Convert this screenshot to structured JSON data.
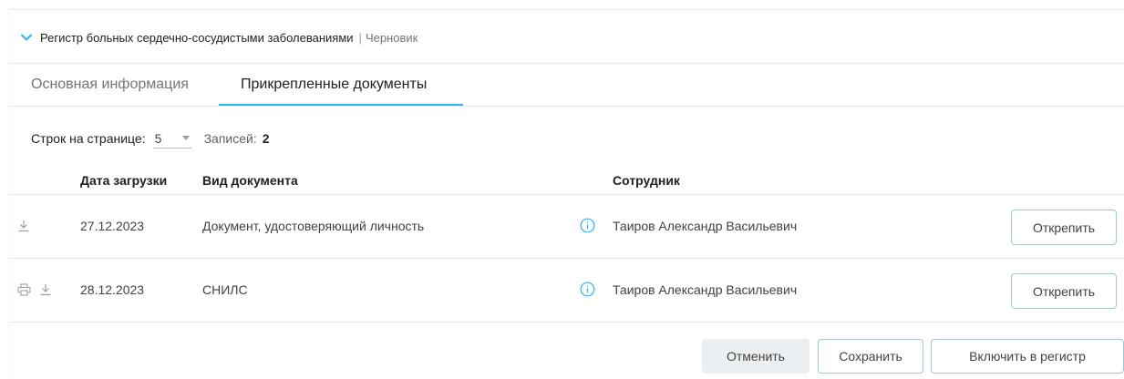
{
  "panel": {
    "title": "Регистр больных сердечно-сосудистыми заболеваниями",
    "separator": "|",
    "status": "Черновик"
  },
  "tabs": [
    {
      "label": "Основная информация",
      "active": false
    },
    {
      "label": "Прикрепленные документы",
      "active": true
    }
  ],
  "pager": {
    "rows_label": "Строк на странице:",
    "rows_value": "5",
    "records_label": "Записей:",
    "records_count": "2"
  },
  "table": {
    "columns": [
      "Дата загрузки",
      "Вид документа",
      "Сотрудник"
    ],
    "rows": [
      {
        "date": "27.12.2023",
        "doc_type": "Документ, удостоверяющий личность",
        "employee": "Таиров Александр Васильевич",
        "action": "Открепить",
        "icons": [
          "download-icon"
        ]
      },
      {
        "date": "28.12.2023",
        "doc_type": "СНИЛС",
        "employee": "Таиров Александр Васильевич",
        "action": "Открепить",
        "icons": [
          "print-icon",
          "download-icon"
        ]
      }
    ]
  },
  "footer": {
    "cancel": "Отменить",
    "save": "Сохранить",
    "include": "Включить в регистр"
  },
  "colors": {
    "accent": "#29b6f6",
    "button_border": "#9bc9d6",
    "cancel_bg": "#eceff1",
    "info_icon": "#29b6f6"
  }
}
